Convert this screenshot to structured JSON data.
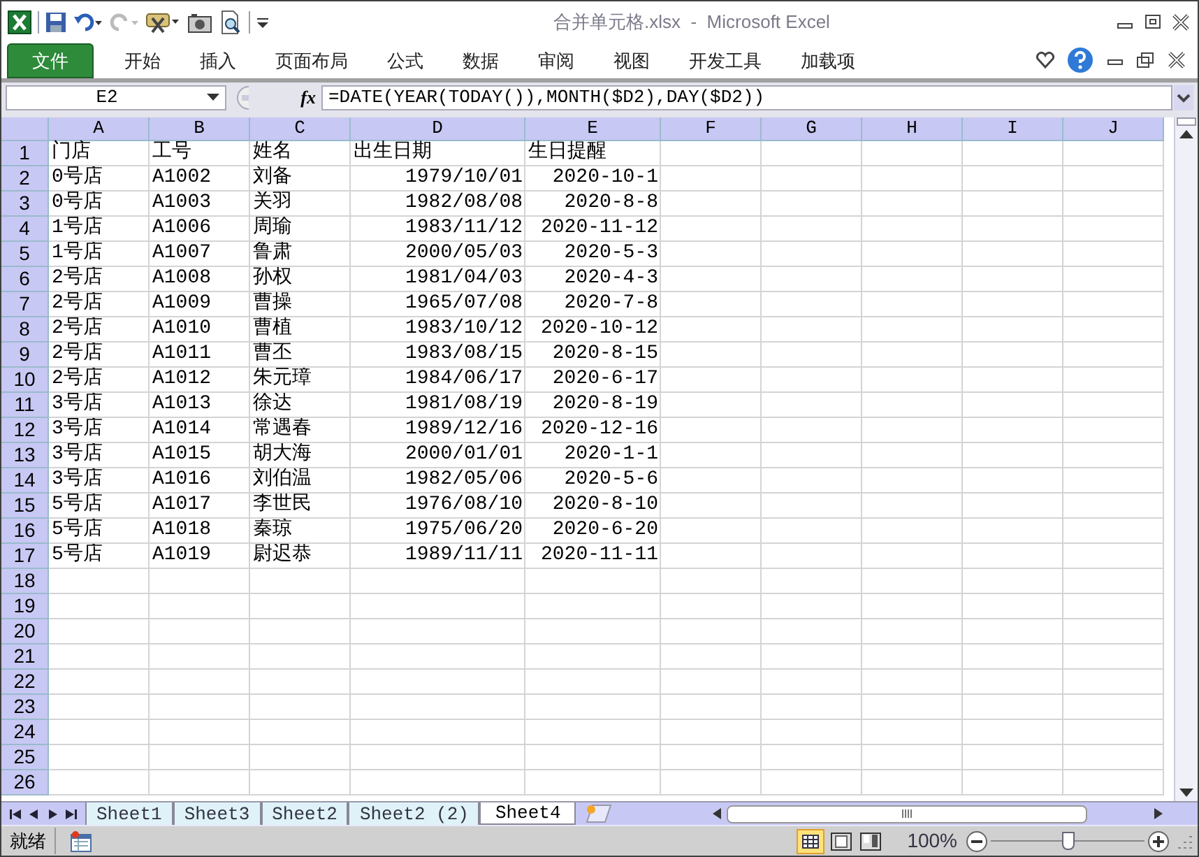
{
  "window": {
    "title": "合并单元格.xlsx  -  Microsoft Excel"
  },
  "ribbon_tabs": [
    {
      "label": "文件",
      "selected": true
    },
    {
      "label": "开始",
      "selected": false
    },
    {
      "label": "插入",
      "selected": false
    },
    {
      "label": "页面布局",
      "selected": false
    },
    {
      "label": "公式",
      "selected": false
    },
    {
      "label": "数据",
      "selected": false
    },
    {
      "label": "审阅",
      "selected": false
    },
    {
      "label": "视图",
      "selected": false
    },
    {
      "label": "开发工具",
      "selected": false
    },
    {
      "label": "加载项",
      "selected": false
    }
  ],
  "formula_bar": {
    "name_box": "E2",
    "fx": "fx",
    "formula": "=DATE(YEAR(TODAY()),MONTH($D2),DAY($D2))"
  },
  "columns": [
    {
      "letter": "A",
      "numeric": false
    },
    {
      "letter": "B",
      "numeric": false
    },
    {
      "letter": "C",
      "numeric": false
    },
    {
      "letter": "D",
      "numeric": true
    },
    {
      "letter": "E",
      "numeric": true
    },
    {
      "letter": "F"
    },
    {
      "letter": "G"
    },
    {
      "letter": "H"
    },
    {
      "letter": "I"
    },
    {
      "letter": "J"
    }
  ],
  "rows": [
    {
      "number": "1",
      "kind": "header",
      "cells": [
        "门店",
        "工号",
        "姓名",
        "出生日期",
        "生日提醒"
      ]
    },
    {
      "number": "2",
      "kind": "data",
      "cells": [
        "0号店",
        "A1002",
        "刘备",
        "1979/10/01",
        "2020-10-1"
      ]
    },
    {
      "number": "3",
      "kind": "data",
      "cells": [
        "0号店",
        "A1003",
        "关羽",
        "1982/08/08",
        "2020-8-8"
      ]
    },
    {
      "number": "4",
      "kind": "data",
      "cells": [
        "1号店",
        "A1006",
        "周瑜",
        "1983/11/12",
        "2020-11-12"
      ]
    },
    {
      "number": "5",
      "kind": "data",
      "cells": [
        "1号店",
        "A1007",
        "鲁肃",
        "2000/05/03",
        "2020-5-3"
      ]
    },
    {
      "number": "6",
      "kind": "data",
      "cells": [
        "2号店",
        "A1008",
        "孙权",
        "1981/04/03",
        "2020-4-3"
      ]
    },
    {
      "number": "7",
      "kind": "data",
      "cells": [
        "2号店",
        "A1009",
        "曹操",
        "1965/07/08",
        "2020-7-8"
      ]
    },
    {
      "number": "8",
      "kind": "data",
      "cells": [
        "2号店",
        "A1010",
        "曹植",
        "1983/10/12",
        "2020-10-12"
      ]
    },
    {
      "number": "9",
      "kind": "data",
      "cells": [
        "2号店",
        "A1011",
        "曹丕",
        "1983/08/15",
        "2020-8-15"
      ]
    },
    {
      "number": "10",
      "kind": "data",
      "cells": [
        "2号店",
        "A1012",
        "朱元璋",
        "1984/06/17",
        "2020-6-17"
      ]
    },
    {
      "number": "11",
      "kind": "data",
      "cells": [
        "3号店",
        "A1013",
        "徐达",
        "1981/08/19",
        "2020-8-19"
      ]
    },
    {
      "number": "12",
      "kind": "data",
      "cells": [
        "3号店",
        "A1014",
        "常遇春",
        "1989/12/16",
        "2020-12-16"
      ]
    },
    {
      "number": "13",
      "kind": "data",
      "cells": [
        "3号店",
        "A1015",
        "胡大海",
        "2000/01/01",
        "2020-1-1"
      ]
    },
    {
      "number": "14",
      "kind": "data",
      "cells": [
        "3号店",
        "A1016",
        "刘伯温",
        "1982/05/06",
        "2020-5-6"
      ]
    },
    {
      "number": "15",
      "kind": "data",
      "cells": [
        "5号店",
        "A1017",
        "李世民",
        "1976/08/10",
        "2020-8-10"
      ]
    },
    {
      "number": "16",
      "kind": "data",
      "cells": [
        "5号店",
        "A1018",
        "秦琼",
        "1975/06/20",
        "2020-6-20"
      ]
    },
    {
      "number": "17",
      "kind": "data",
      "cells": [
        "5号店",
        "A1019",
        "尉迟恭",
        "1989/11/11",
        "2020-11-11"
      ]
    },
    {
      "number": "18",
      "kind": "data",
      "cells": []
    },
    {
      "number": "19",
      "kind": "data",
      "cells": []
    },
    {
      "number": "20",
      "kind": "data",
      "cells": []
    },
    {
      "number": "21",
      "kind": "data",
      "cells": []
    },
    {
      "number": "22",
      "kind": "data",
      "cells": []
    },
    {
      "number": "23",
      "kind": "data",
      "cells": []
    },
    {
      "number": "24",
      "kind": "data",
      "cells": []
    },
    {
      "number": "25",
      "kind": "data",
      "cells": []
    },
    {
      "number": "26",
      "kind": "data",
      "cells": []
    }
  ],
  "sheet_tabs": [
    {
      "label": "Sheet1",
      "selected": false
    },
    {
      "label": "Sheet3",
      "selected": false
    },
    {
      "label": "Sheet2",
      "selected": false
    },
    {
      "label": "Sheet2 (2)",
      "selected": false
    },
    {
      "label": "Sheet4",
      "selected": true
    }
  ],
  "status_bar": {
    "status": "就绪",
    "zoom": "100%",
    "zoom_slider": {
      "level": 0.5
    }
  }
}
